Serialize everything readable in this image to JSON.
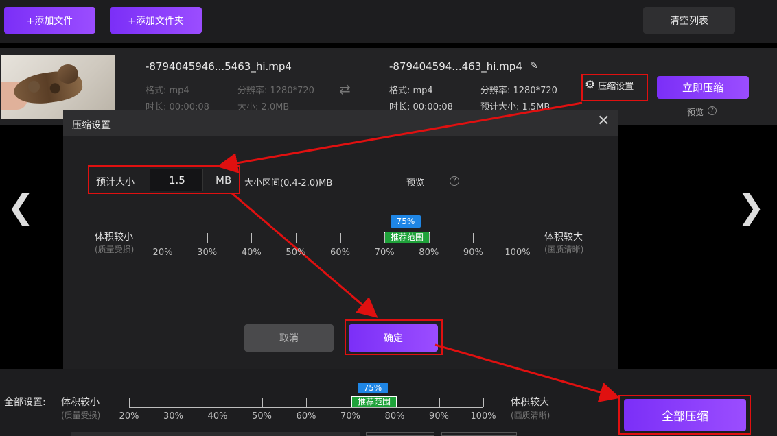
{
  "toolbar": {
    "add_file": "+添加文件",
    "add_folder": "+添加文件夹",
    "clear_list": "清空列表"
  },
  "file": {
    "source_name": "-8794045946...5463_hi.mp4",
    "source_format": "格式: mp4",
    "source_resolution": "分辨率: 1280*720",
    "source_duration": "时长: 00:00:08",
    "source_size": "大小: 2.0MB",
    "target_name": "-879404594...463_hi.mp4",
    "target_format": "格式: mp4",
    "target_resolution": "分辨率: 1280*720",
    "target_duration": "时长: 00:00:08",
    "target_size": "预计大小: 1.5MB",
    "compress_settings": "压缩设置",
    "compress_now": "立即压缩",
    "preview": "预览"
  },
  "dialog": {
    "title": "压缩设置",
    "estimated_size_label": "预计大小",
    "estimated_size_value": "1.5",
    "unit": "MB",
    "range_hint": "大小区间(0.4-2.0)MB",
    "preview": "预览",
    "left_title": "体积较小",
    "left_sub": "(质量受损)",
    "right_title": "体积较大",
    "right_sub": "(画质清晰)",
    "current_percent": "75%",
    "recommended": "推荐范围",
    "ticks": [
      "20%",
      "30%",
      "40%",
      "50%",
      "60%",
      "70%",
      "80%",
      "90%",
      "100%"
    ],
    "cancel": "取消",
    "confirm": "确定"
  },
  "global": {
    "label": "全部设置:",
    "left_title": "体积较小",
    "left_sub": "(质量受损)",
    "right_title": "体积较大",
    "right_sub": "(画质清晰)",
    "current_percent": "75%",
    "recommended": "推荐范围",
    "ticks": [
      "20%",
      "30%",
      "40%",
      "50%",
      "60%",
      "70%",
      "80%",
      "90%",
      "100%"
    ],
    "compress_all": "全部压缩"
  },
  "colors": {
    "accent": "#8a3cff",
    "annotation": "#e01010",
    "badge_blue": "#1f86e5",
    "badge_green": "#1fa23a"
  }
}
